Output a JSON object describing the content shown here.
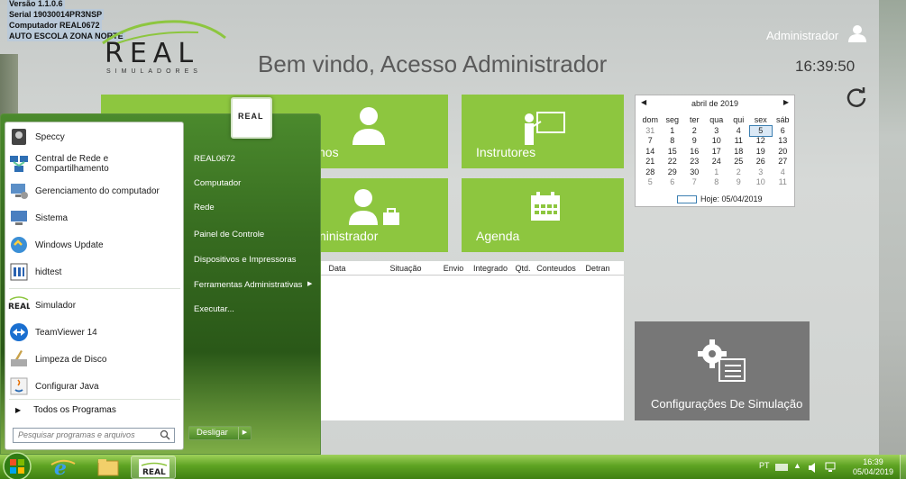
{
  "sysinfo": {
    "version": "Versão 1.1.0.6",
    "serial": "Serial 19030014PR3NSP",
    "computer": "Computador REAL0672",
    "school": "AUTO ESCOLA ZONA NORTE"
  },
  "logo": {
    "word": "REAL",
    "sub": "SIMULADORES"
  },
  "header": {
    "welcome": "Bem vindo, Acesso Administrador",
    "user": "Administrador",
    "time": "16:39:50"
  },
  "tiles": [
    {
      "label": "nos"
    },
    {
      "label": "Instrutores"
    },
    {
      "label": "ninistrador"
    },
    {
      "label": "Agenda"
    },
    {
      "label": "Configurações De Simulação"
    }
  ],
  "calendar": {
    "month": "abril de 2019",
    "weekdays": [
      "dom",
      "seg",
      "ter",
      "qua",
      "qui",
      "sex",
      "sáb"
    ],
    "weeks": [
      [
        "31",
        "1",
        "2",
        "3",
        "4",
        "5",
        "6"
      ],
      [
        "7",
        "8",
        "9",
        "10",
        "11",
        "12",
        "13"
      ],
      [
        "14",
        "15",
        "16",
        "17",
        "18",
        "19",
        "20"
      ],
      [
        "21",
        "22",
        "23",
        "24",
        "25",
        "26",
        "27"
      ],
      [
        "28",
        "29",
        "30",
        "1",
        "2",
        "3",
        "4"
      ],
      [
        "5",
        "6",
        "7",
        "8",
        "9",
        "10",
        "11"
      ]
    ],
    "today_label": "Hoje: 05/04/2019"
  },
  "grid": {
    "columns": [
      "Data",
      "Situação",
      "Envio",
      "Integrado",
      "Qtd.",
      "Conteudos",
      "Detran"
    ]
  },
  "start_menu": {
    "left_items": [
      {
        "label": "Speccy",
        "icon": "speccy-icon"
      },
      {
        "label": "Central de Rede e Compartilhamento",
        "icon": "network-icon"
      },
      {
        "label": "Gerenciamento do computador",
        "icon": "computer-management-icon"
      },
      {
        "label": "Sistema",
        "icon": "system-icon"
      },
      {
        "label": "Windows Update",
        "icon": "windows-update-icon"
      },
      {
        "label": "hidtest",
        "icon": "hidtest-icon"
      },
      {
        "label": "Simulador",
        "icon": "real-logo-icon"
      },
      {
        "label": "TeamViewer 14",
        "icon": "teamviewer-icon"
      },
      {
        "label": "Limpeza de Disco",
        "icon": "disk-cleanup-icon"
      },
      {
        "label": "Configurar Java",
        "icon": "java-icon"
      }
    ],
    "all_programs": "Todos os Programas",
    "search_placeholder": "Pesquisar programas e arquivos",
    "right_items": [
      "REAL0672",
      "Computador",
      "Rede",
      "Painel de Controle",
      "Dispositivos e Impressoras",
      "Ferramentas Administrativas",
      "Executar..."
    ],
    "shutdown": "Desligar",
    "user_picture_text": "REAL"
  },
  "taskbar": {
    "lang": "PT",
    "time": "16:39",
    "date": "05/04/2019",
    "active_app": "REAL"
  }
}
